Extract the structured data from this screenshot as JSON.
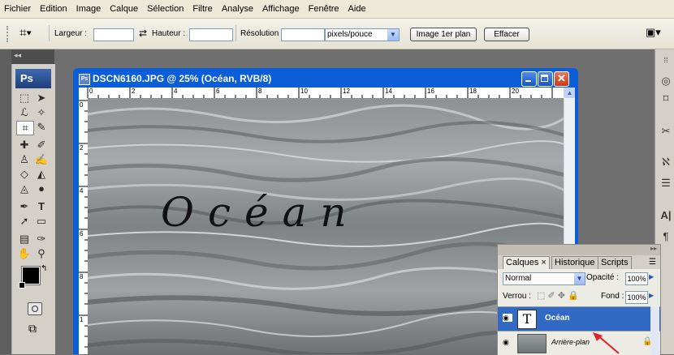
{
  "menu": [
    "Fichier",
    "Edition",
    "Image",
    "Calque",
    "Sélection",
    "Filtre",
    "Analyse",
    "Affichage",
    "Fenêtre",
    "Aide"
  ],
  "options": {
    "width_label": "Largeur :",
    "height_label": "Hauteur :",
    "resolution_label": "Résolution :",
    "unit_value": "pixels/pouce",
    "front_image_button": "Image 1er plan",
    "clear_button": "Effacer"
  },
  "toolbox": {
    "logo": "Ps"
  },
  "document": {
    "title": "DSCN6160.JPG @ 25% (Océan, RVB/8)",
    "ruler_h_ticks": [
      "0",
      "2",
      "4",
      "6",
      "8",
      "10",
      "12",
      "14",
      "16",
      "18",
      "20"
    ],
    "ruler_v_ticks": [
      "0",
      "2",
      "4",
      "6",
      "8",
      "1"
    ],
    "canvas_text": "Océan"
  },
  "layers_panel": {
    "tabs": [
      "Calques ×",
      "Historique",
      "Scripts"
    ],
    "blend_mode": "Normal",
    "opacity_label": "Opacité :",
    "opacity_value": "100%",
    "lock_label": "Verrou :",
    "fill_label": "Fond :",
    "fill_value": "100%",
    "layers": [
      {
        "name": "Océan",
        "thumb": "T",
        "selected": true
      },
      {
        "name": "Arrière-plan",
        "selected": false
      }
    ]
  },
  "colors": {
    "title_bar": "#0b5ed7",
    "selected_layer": "#316ac5",
    "annotation_arrow": "#e0202a"
  }
}
